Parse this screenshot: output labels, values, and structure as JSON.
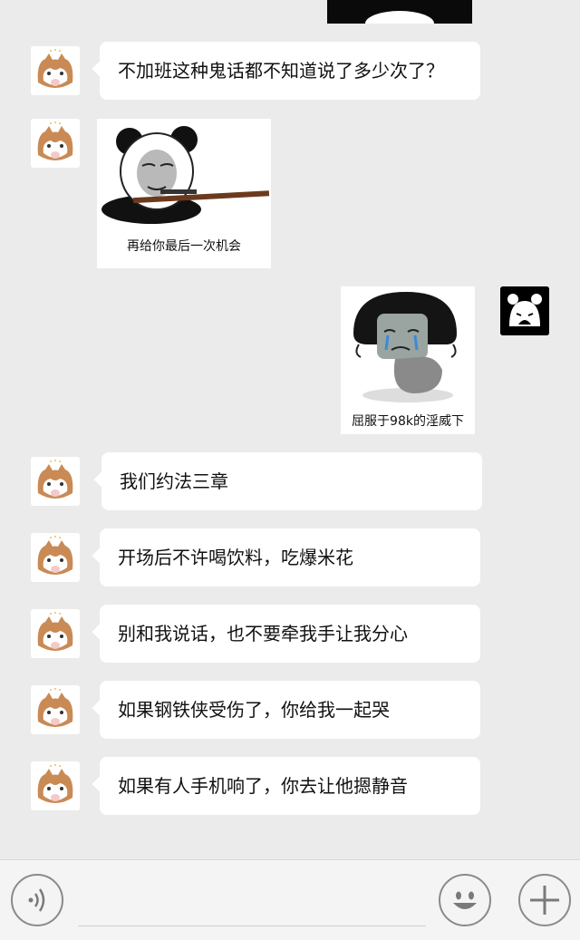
{
  "messages": [
    {
      "from": "other",
      "type": "text",
      "text": "不加班这种鬼话都不知道说了多少次了？"
    },
    {
      "from": "other",
      "type": "sticker",
      "caption": "再给你最后一次机会"
    },
    {
      "from": "me",
      "type": "sticker",
      "caption": "屈服于98k的淫威下"
    },
    {
      "from": "other",
      "type": "text",
      "text": "我们约法三章"
    },
    {
      "from": "other",
      "type": "text",
      "text": "开场后不许喝饮料，吃爆米花"
    },
    {
      "from": "other",
      "type": "text",
      "text": "别和我说话，也不要牵我手让我分心"
    },
    {
      "from": "other",
      "type": "text",
      "text": "如果钢铁侠受伤了，你给我一起哭"
    },
    {
      "from": "other",
      "type": "text",
      "text": "如果有人手机响了，你去让他摁静音"
    }
  ],
  "input_bar": {
    "voice_icon": "voice-icon",
    "emoji_icon": "emoji-icon",
    "plus_icon": "plus-icon"
  },
  "colors": {
    "background": "#ebebeb",
    "bubble": "#ffffff",
    "bar": "#f4f4f4"
  }
}
